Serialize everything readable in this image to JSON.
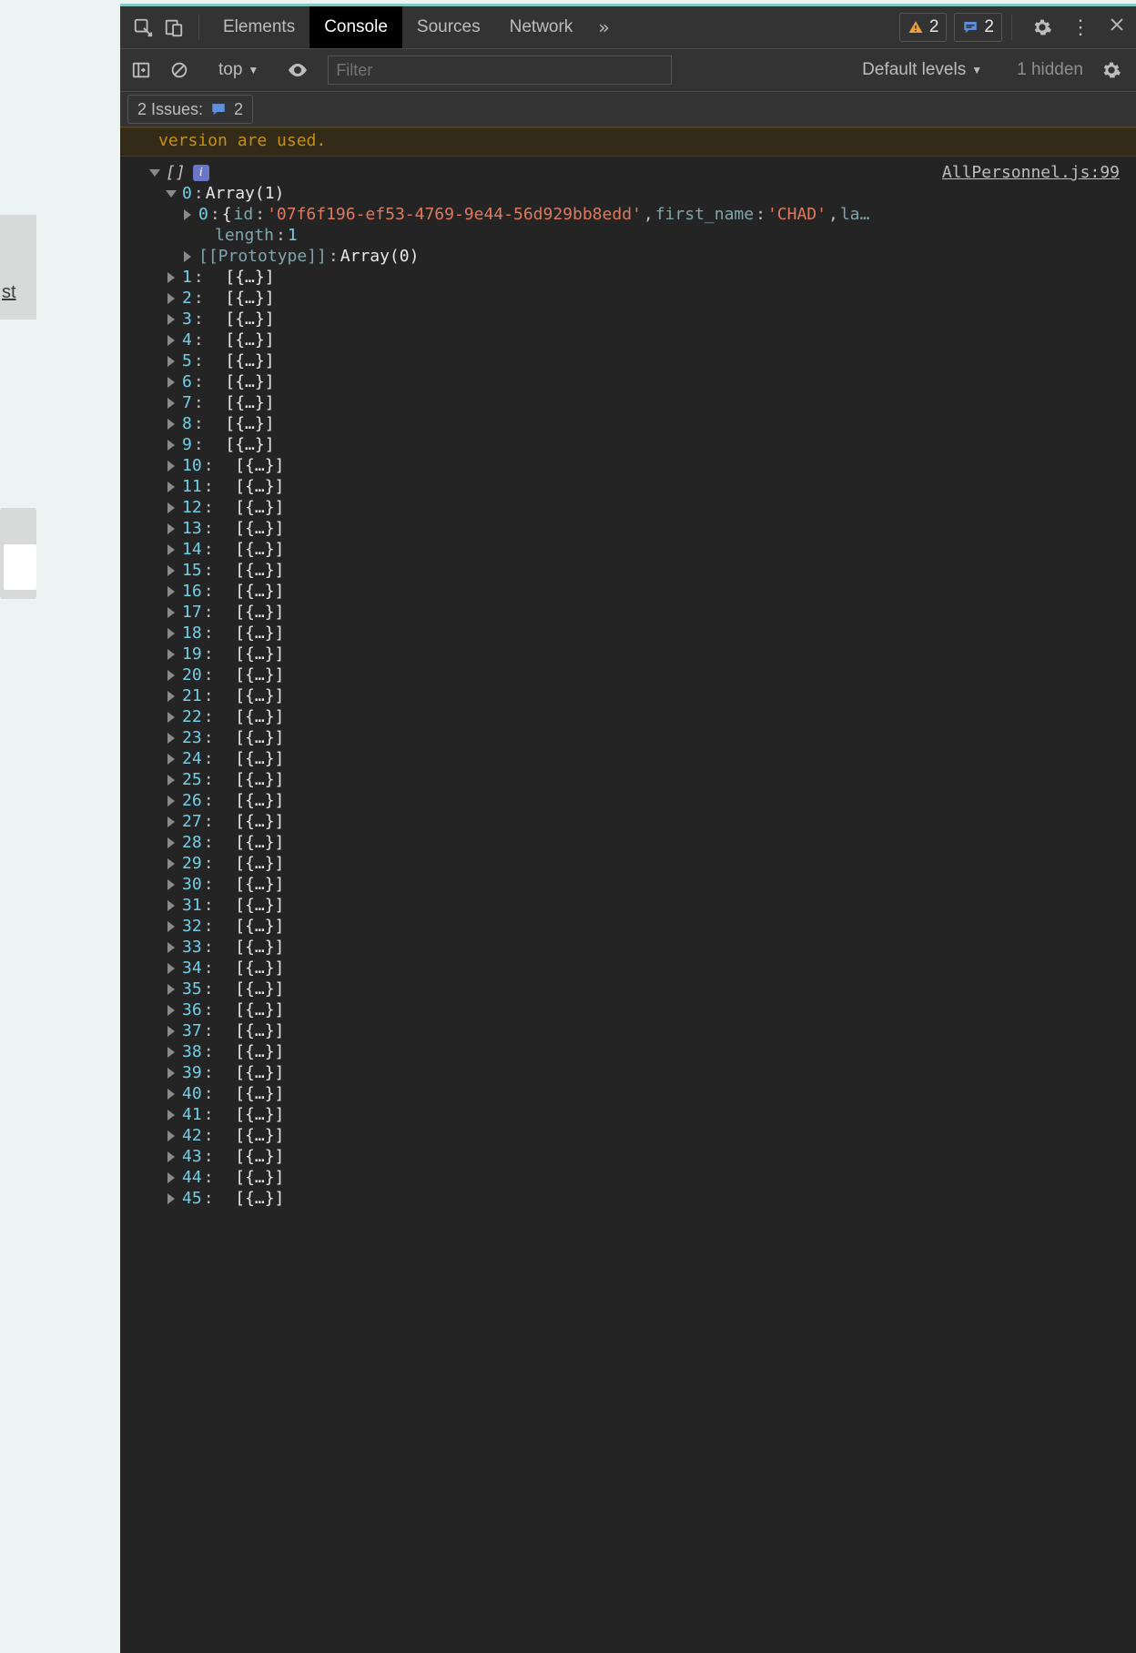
{
  "left_fragment_text": "st",
  "tabs": {
    "elements": "Elements",
    "console": "Console",
    "sources": "Sources",
    "network": "Network",
    "more": "»"
  },
  "counters": {
    "warnings": "2",
    "messages": "2"
  },
  "sub": {
    "context": "top",
    "filter_placeholder": "Filter",
    "levels": "Default levels",
    "hidden": "1 hidden"
  },
  "issues": {
    "label": "2 Issues:",
    "count": "2"
  },
  "warning_line": "version are used.",
  "source_link": "AllPersonnel.js:99",
  "root": {
    "label": "[]",
    "info": "i"
  },
  "item0": {
    "index": "0",
    "summary": "Array(1)",
    "child_index": "0",
    "child_open": "{",
    "kv": [
      {
        "k": "id",
        "v": "'07f6f196-ef53-4769-9e44-56d929bb8edd'"
      },
      {
        "k": "first_name",
        "v": "'CHAD'"
      },
      {
        "k": "la…",
        "v": ""
      }
    ],
    "length_label": "length",
    "length_value": "1",
    "proto_label": "[[Prototype]]",
    "proto_value": "Array(0)"
  },
  "collapsed_label": "[{…}]",
  "collapsed_indices": [
    "1",
    "2",
    "3",
    "4",
    "5",
    "6",
    "7",
    "8",
    "9",
    "10",
    "11",
    "12",
    "13",
    "14",
    "15",
    "16",
    "17",
    "18",
    "19",
    "20",
    "21",
    "22",
    "23",
    "24",
    "25",
    "26",
    "27",
    "28",
    "29",
    "30",
    "31",
    "32",
    "33",
    "34",
    "35",
    "36",
    "37",
    "38",
    "39",
    "40",
    "41",
    "42",
    "43",
    "44",
    "45"
  ]
}
